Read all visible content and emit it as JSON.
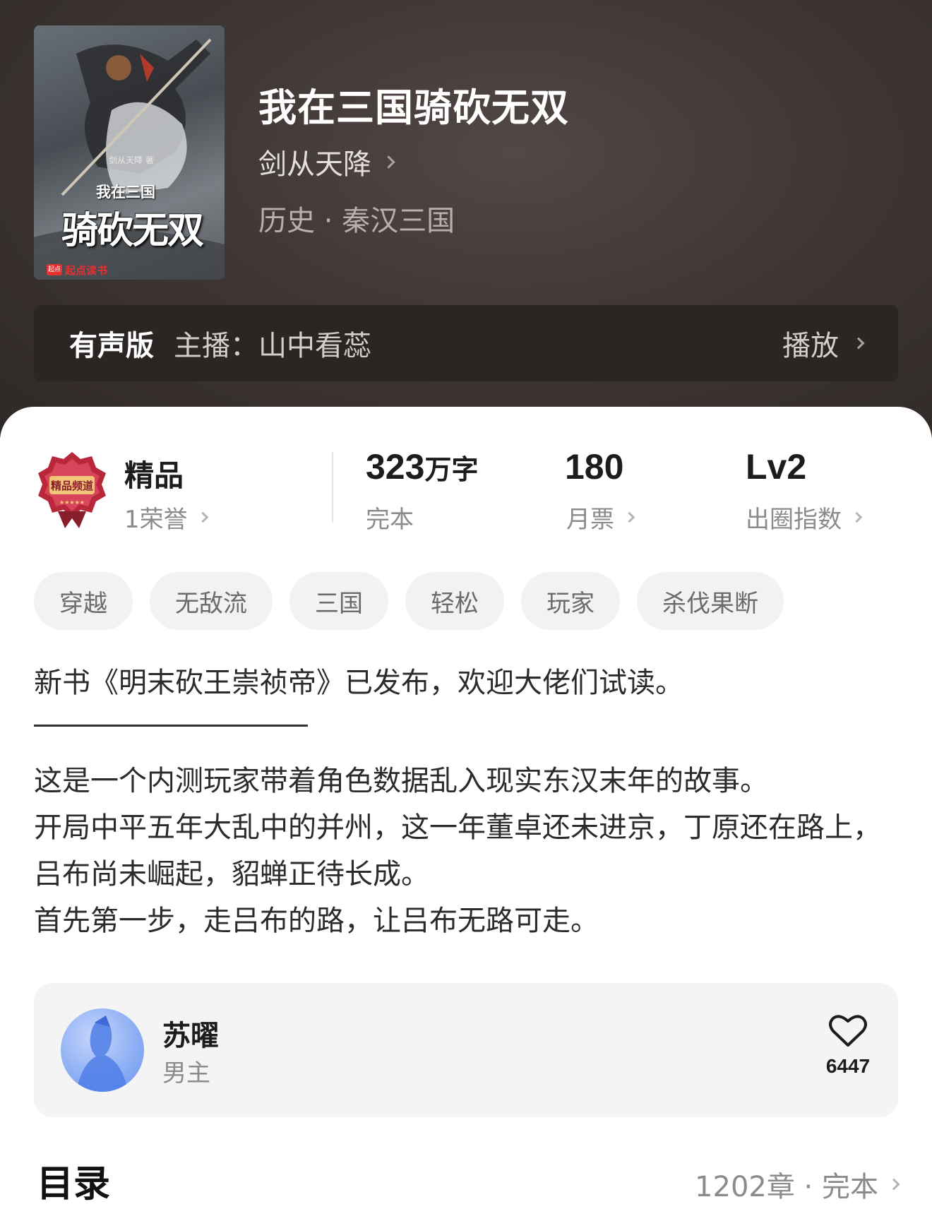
{
  "book": {
    "title": "我在三国骑砍无双",
    "author": "剑从天降",
    "genre": "历史 · 秦汉三国",
    "cover": {
      "author_text": "剑从天降 著",
      "subtitle": "我在三国",
      "main_title": "骑砍无双",
      "badge": "起点",
      "brand": "起点读书"
    }
  },
  "audio": {
    "label": "有声版",
    "host": "主播：山中看蕊",
    "play_label": "播放"
  },
  "stats": {
    "quality": {
      "title": "精品",
      "sub": "1荣誉",
      "medal_text": "精品频道"
    },
    "words": {
      "number": "323",
      "unit": "万字",
      "sub": "完本"
    },
    "tickets": {
      "number": "180",
      "sub": "月票"
    },
    "level": {
      "number": "Lv2",
      "sub": "出圈指数"
    }
  },
  "tags": [
    "穿越",
    "无敌流",
    "三国",
    "轻松",
    "玩家",
    "杀伐果断"
  ],
  "intro": {
    "notice": "新书《明末砍王崇祯帝》已发布，欢迎大佬们试读。",
    "divider": "——————————",
    "lines": [
      "这是一个内测玩家带着角色数据乱入现实东汉末年的故事。",
      "开局中平五年大乱中的并州，这一年董卓还未进京，丁原还在路上，吕布尚未崛起，貂蝉正待长成。",
      "首先第一步，走吕布的路，让吕布无路可走。"
    ]
  },
  "character": {
    "name": "苏曜",
    "role": "男主",
    "likes": "6447"
  },
  "toc": {
    "title": "目录",
    "meta": "1202章 · 完本"
  },
  "colors": {
    "hero_bg": "#3f3734",
    "audio_bg": "#2b2524",
    "tag_bg": "#f2f2f2",
    "card_bg": "#f4f4f4",
    "brand_red": "#e5312f",
    "avatar_blue": "#8fb0f5"
  },
  "icons": {
    "chevron": "chevron-right-icon",
    "like": "heart-icon",
    "medal": "quality-medal-icon"
  }
}
